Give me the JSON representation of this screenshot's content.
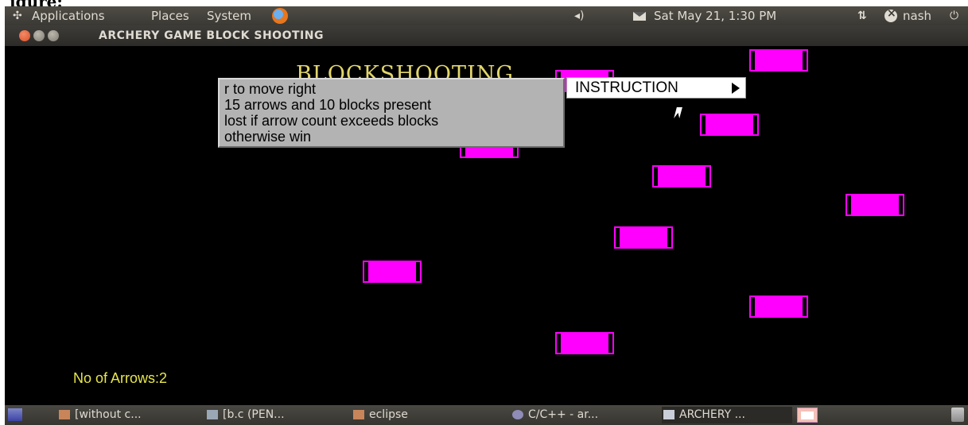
{
  "caption": "igure:",
  "top_panel": {
    "applications": "Applications",
    "places": "Places",
    "system": "System",
    "clock": "Sat May 21,  1:30 PM",
    "user": "nash",
    "icons": [
      "gnome-logo-icon",
      "firefox-icon",
      "volume-icon",
      "mail-icon",
      "network-icon",
      "user-status-icon",
      "power-icon"
    ]
  },
  "window": {
    "title": "ARCHERY GAME BLOCK SHOOTING"
  },
  "game": {
    "title": "BLOCKSHOOTING",
    "instruction_lines": [
      "r to move right",
      "15 arrows and 10 blocks present",
      "lost if arrow count exceeds blocks",
      "otherwise win"
    ],
    "instruction_button": "INSTRUCTION",
    "arrows_label": "No of Arrows:2",
    "block_count_visible": 9,
    "colors": {
      "block": "#ff00ff",
      "title": "#e2d66a",
      "arrows_label": "#e6e64b",
      "background": "#000000"
    }
  },
  "taskbar": {
    "tasks": [
      {
        "label": "[without c...",
        "icon": "folder-icon"
      },
      {
        "label": "[b.c (PEN...",
        "icon": "text-editor-icon"
      },
      {
        "label": "eclipse",
        "icon": "folder-icon"
      },
      {
        "label": "C/C++ - ar...",
        "icon": "eclipse-icon"
      },
      {
        "label": "ARCHERY ...",
        "icon": "window-icon",
        "active": true
      }
    ]
  }
}
